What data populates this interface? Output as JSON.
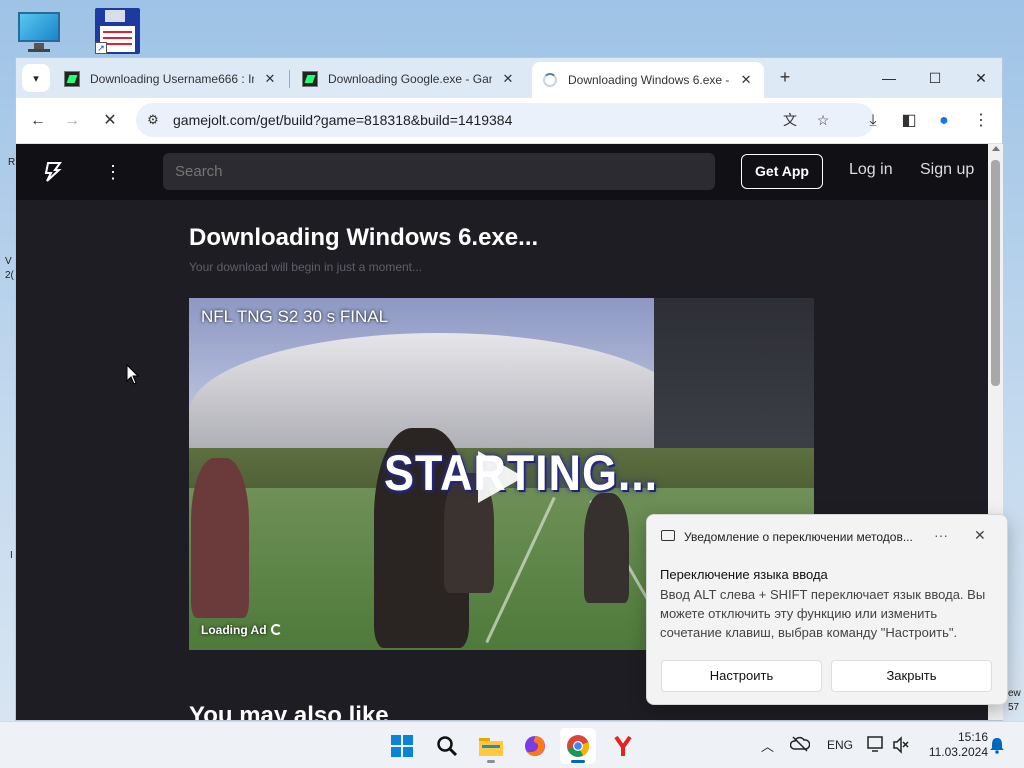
{
  "desktop": {
    "icons": [
      "computer-icon",
      "floppy-shortcut-icon"
    ],
    "edge_left": [
      "R",
      "V",
      "2(",
      "I"
    ],
    "edge_right": [
      "ew",
      "57"
    ]
  },
  "browser": {
    "tabs": [
      {
        "title": "Downloading Username666 : In",
        "close": "✕"
      },
      {
        "title": "Downloading Google.exe - Gam",
        "close": "✕"
      },
      {
        "title": "Downloading Windows 6.exe -",
        "close": "✕"
      }
    ],
    "new_tab": "+",
    "url": "gamejolt.com/get/build?game=818318&build=1419384"
  },
  "page": {
    "search_placeholder": "Search",
    "get_app": "Get App",
    "login": "Log in",
    "signup": "Sign up",
    "title": "Downloading Windows 6.exe...",
    "subtitle": "Your download will begin in just a moment...",
    "ad": {
      "title": "NFL TNG S2 30 s FINAL",
      "overlay_text": "STARTING...",
      "loading": "Loading Ad"
    },
    "also_like": "You may also like"
  },
  "notification": {
    "app": "Уведомление о переключении методов...",
    "more": "···",
    "heading": "Переключение языка ввода",
    "body": "Ввод ALT слева + SHIFT переключает язык ввода. Вы можете отключить эту функцию или изменить сочетание клавиш, выбрав команду \"Настроить\".",
    "configure": "Настроить",
    "close": "Закрыть"
  },
  "taskbar": {
    "apps": [
      "start",
      "search",
      "file-explorer",
      "firefox",
      "chrome",
      "yandex"
    ],
    "active_app": "chrome",
    "lang": "ENG",
    "time": "15:16",
    "date": "11.03.2024"
  },
  "colors": {
    "page_bg": "#1e1d24",
    "nav_bg": "#111015",
    "tabbar_bg": "#dee9f6",
    "accent": "#0067c0"
  }
}
